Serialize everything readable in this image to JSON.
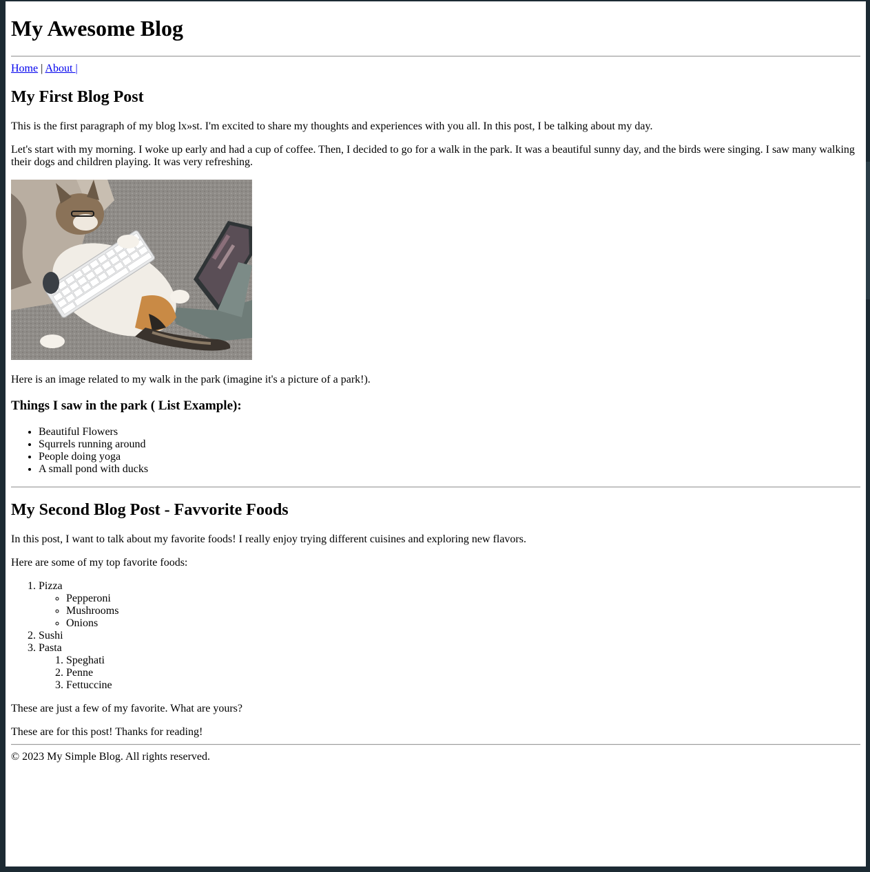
{
  "site": {
    "title": "My Awesome Blog",
    "nav": [
      {
        "label": "Home",
        "sep": " | "
      },
      {
        "label": "About ",
        "sep": "|"
      }
    ]
  },
  "post1": {
    "title": "My First Blog Post",
    "paragraphs": [
      "This is the first paragraph of my blog lx»st. I'm excited to share my thoughts and experiences with you all. In this post, I be talking about my day.",
      "Let's start with my morning. I woke up early and had a cup of coffee. Then, I decided to go for a walk in the park. It was a beautiful sunny day, and the birds were singing. I saw many walking their dogs and children playing. It was very refreshing."
    ],
    "image_caption": "Here is an image related to my walk in the park (imagine it's a picture of a park!).",
    "list_heading": "Things I saw in the park ( List Example):",
    "list": [
      "Beautiful Flowers",
      "Squrrels running around",
      "People doing yoga",
      "A small pond with ducks"
    ]
  },
  "post2": {
    "title": "My Second Blog Post - Favvorite Foods",
    "intro": "In this post, I want to talk about my favorite foods! I really enjoy trying different cuisines and exploring new flavors.",
    "list_intro": "Here are some of my top favorite foods:",
    "foods": [
      {
        "name": "Pizza",
        "sub_type": "ul",
        "items": [
          "Pepperoni",
          "Mushrooms",
          "Onions"
        ]
      },
      {
        "name": "Sushi",
        "sub_type": "",
        "items": []
      },
      {
        "name": "Pasta",
        "sub_type": "ol",
        "items": [
          "Speghati",
          "Penne",
          "Fettuccine"
        ]
      }
    ],
    "closing1": "These are just a few of my favorite. What are yours?",
    "closing2": "These are for this post! Thanks for reading!"
  },
  "footer": {
    "text": "© 2023 My Simple Blog. All rights reserved."
  }
}
